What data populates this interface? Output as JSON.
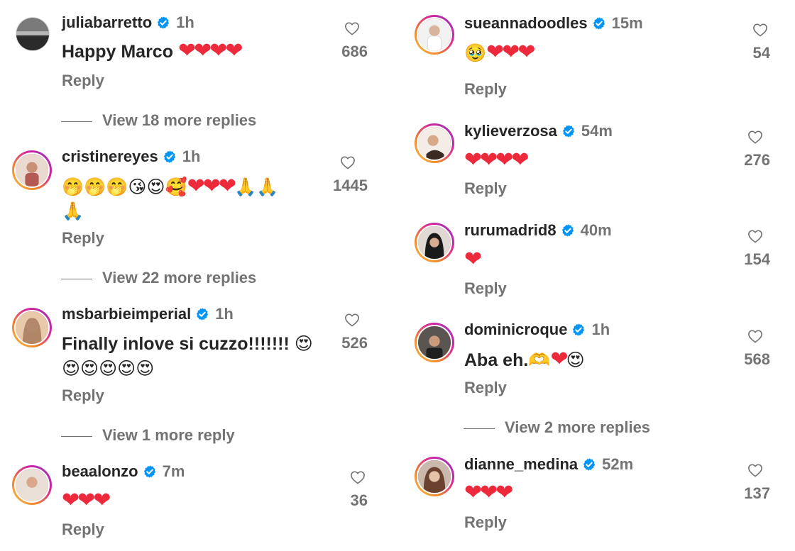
{
  "left": [
    {
      "username": "juliabarretto",
      "time": "1h",
      "text": "Happy Marco",
      "emoji": "",
      "hearts": "❤❤❤❤",
      "extra": "",
      "likes": "686",
      "reply": "Reply",
      "view_replies": "View 18 more replies"
    },
    {
      "username": "cristinereyes",
      "time": "1h",
      "text": "",
      "emoji": "🤭🤭🤭😘😍🥰",
      "hearts": "❤❤❤",
      "extra": "🙏🙏",
      "extra2": "🙏",
      "likes": "1445",
      "reply": "Reply",
      "view_replies": "View 22 more replies"
    },
    {
      "username": "msbarbieimperial",
      "time": "1h",
      "text": "Finally inlove si cuzzo!!!!!!!",
      "emoji": "😍",
      "extra2": "😍😍😍😍😍",
      "likes": "526",
      "reply": "Reply",
      "view_replies": "View 1 more reply"
    },
    {
      "username": "beaalonzo",
      "time": "7m",
      "text": "",
      "hearts": "❤❤❤",
      "likes": "36",
      "reply": "Reply"
    }
  ],
  "right": [
    {
      "username": "sueannadoodles",
      "time": "15m",
      "emoji": "🥹",
      "hearts": "❤❤❤",
      "likes": "54",
      "reply": "Reply"
    },
    {
      "username": "kylieverzosa",
      "time": "54m",
      "hearts": "❤❤❤❤",
      "likes": "276",
      "reply": "Reply"
    },
    {
      "username": "rurumadrid8",
      "time": "40m",
      "hearts": "❤",
      "likes": "154",
      "reply": "Reply"
    },
    {
      "username": "dominicroque",
      "time": "1h",
      "text": "Aba eh.",
      "emoji": "🫶",
      "hearts": "❤",
      "emoji_after": "😍",
      "likes": "568",
      "reply": "Reply",
      "view_replies": "View 2 more replies"
    },
    {
      "username": "dianne_medina",
      "time": "52m",
      "hearts": "❤❤❤",
      "likes": "137",
      "reply": "Reply"
    }
  ],
  "colors": {
    "heart": "#ed2a3c",
    "verified": "#0095f6",
    "muted": "#737373",
    "text": "#262626"
  },
  "icons": {
    "like": "heart-outline-icon",
    "verified": "verified-badge-icon"
  }
}
